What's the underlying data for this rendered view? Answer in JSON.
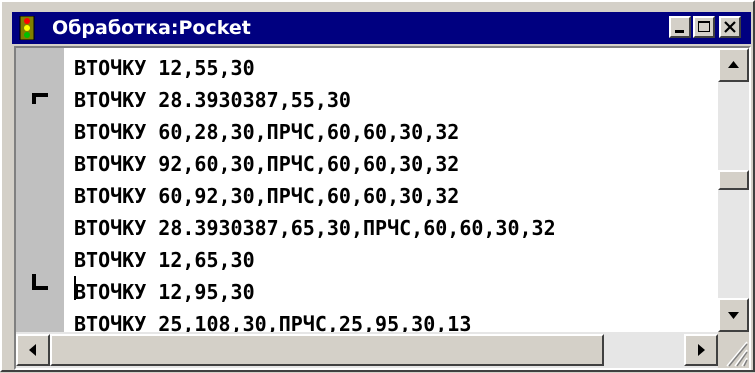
{
  "window": {
    "title": "Обработка:Pocket",
    "icon": "traffic-light-icon"
  },
  "titlebar_buttons": {
    "minimize": "minimize-icon",
    "maximize": "maximize-icon",
    "close": "close-icon"
  },
  "editor": {
    "lines": [
      "ВТОЧКУ 12,55,30",
      "ВТОЧКУ 28.3930387,55,30",
      "ВТОЧКУ 60,28,30,ПРЧС,60,60,30,32",
      "ВТОЧКУ 92,60,30,ПРЧС,60,60,30,32",
      "ВТОЧКУ 60,92,30,ПРЧС,60,60,30,32",
      "ВТОЧКУ 28.3930387,65,30,ПРЧС,60,60,30,32",
      "ВТОЧКУ 12,65,30",
      "ВТОЧКУ 12,95,30",
      "ВТОЧКУ 25,108,30,ПРЧС,25,95,30,13"
    ],
    "gutter_markers": [
      "bracket-start-icon",
      "bracket-end-icon"
    ]
  },
  "scrollbars": {
    "up": "arrow-up-icon",
    "down": "arrow-down-icon",
    "left": "arrow-left-icon",
    "right": "arrow-right-icon",
    "grip": "resize-grip-icon"
  }
}
